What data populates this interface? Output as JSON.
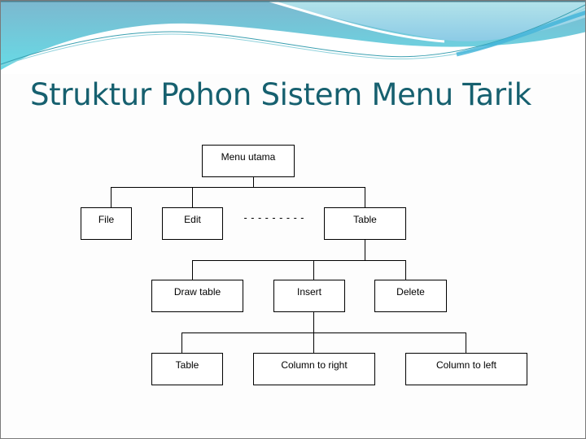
{
  "slide": {
    "title": "Struktur Pohon Sistem Menu Tarik",
    "theme_colors": {
      "title": "#16606f",
      "wave_dark": "#7fbfd4",
      "wave_light": "#a9dde8",
      "wave_cyan": "#66d9e6"
    }
  },
  "tree": {
    "root": {
      "label": "Menu utama"
    },
    "level1": [
      {
        "label": "File"
      },
      {
        "label": "Edit"
      },
      {
        "label": "---------"
      },
      {
        "label": "Table"
      }
    ],
    "level2": [
      {
        "label": "Draw table",
        "parent": "Table"
      },
      {
        "label": "Insert",
        "parent": "Table"
      },
      {
        "label": "Delete",
        "parent": "Table"
      }
    ],
    "level3": [
      {
        "label": "Table",
        "parent": "Insert"
      },
      {
        "label": "Column to right",
        "parent": "Insert"
      },
      {
        "label": "Column to left",
        "parent": "Insert"
      }
    ]
  }
}
